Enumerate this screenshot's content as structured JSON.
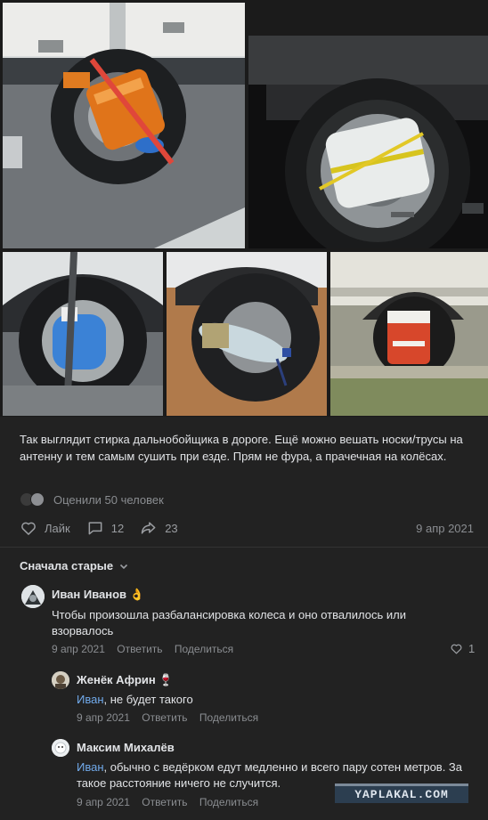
{
  "post": {
    "text": "Так выглядит стирка дальнобойщика в дороге. Ещё можно вешать носки/трусы на антенну и тем самым сушить при езде. Прям не фура, а прачечная на колёсах.",
    "likes_summary": "Оценили 50 человек",
    "actions": {
      "like_label": "Лайк",
      "comments_count": "12",
      "shares_count": "23"
    },
    "date": "9 апр 2021"
  },
  "comments": {
    "sort_label": "Сначала старые",
    "items": [
      {
        "name": "Иван Иванов 👌",
        "text": "Чтобы произошла разбалансировка колеса и оно отвалилось или взорвалось",
        "date": "9 апр 2021",
        "reply": "Ответить",
        "share": "Поделиться",
        "likes": "1"
      },
      {
        "name": "Женёк Африн 🍷",
        "mention": "Иван",
        "text": ", не будет такого",
        "date": "9 апр 2021",
        "reply": "Ответить",
        "share": "Поделиться"
      },
      {
        "name": "Максим Михалёв",
        "mention": "Иван",
        "text": ", обычно с ведёрком едут медленно и всего пару сотен метров. За такое расстояние ничего не случится.",
        "date": "9 апр 2021",
        "reply": "Ответить",
        "share": "Поделиться"
      }
    ]
  },
  "watermark": "YAPLAKAL.COM",
  "colors": {
    "background": "#222222",
    "text": "#e1e3e6",
    "secondary": "#8a8d91",
    "link": "#71aaeb"
  }
}
